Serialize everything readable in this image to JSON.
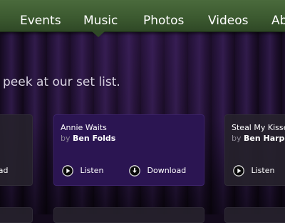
{
  "nav": {
    "items": [
      {
        "label": "Events"
      },
      {
        "label": "Music"
      },
      {
        "label": "Photos"
      },
      {
        "label": "Videos"
      },
      {
        "label": "Ab"
      }
    ],
    "active": "Music"
  },
  "tagline": "peek at our set list.",
  "cards": [
    {
      "title": "",
      "by": "",
      "artist": "",
      "download_label": "oad"
    },
    {
      "title": "Annie Waits",
      "by": "by",
      "artist": "Ben Folds",
      "listen_label": "Listen",
      "download_label": "Download"
    },
    {
      "title": "Steal My Kisse",
      "by": "by",
      "artist": "Ben Harper",
      "listen_label": "Listen"
    }
  ],
  "colors": {
    "nav_green": "#3c5a30",
    "active_card": "#2b1552",
    "curtain": "#221236"
  },
  "icons": [
    "play-icon",
    "download-icon"
  ]
}
